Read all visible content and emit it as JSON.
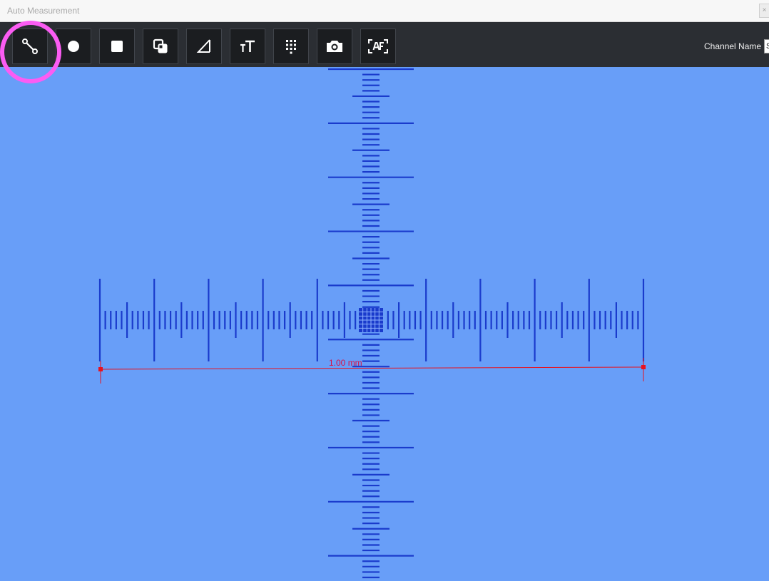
{
  "window": {
    "title": "Auto Measurement",
    "close_glyph": "×"
  },
  "toolbar": {
    "tools": [
      {
        "id": "line",
        "icon": "line-measure-icon"
      },
      {
        "id": "circle",
        "icon": "circle-icon"
      },
      {
        "id": "rectangle",
        "icon": "square-icon"
      },
      {
        "id": "overlap",
        "icon": "overlap-squares-icon"
      },
      {
        "id": "angle",
        "icon": "angle-triangle-icon"
      },
      {
        "id": "text",
        "icon": "text-size-icon"
      },
      {
        "id": "grid",
        "icon": "dot-grid-icon"
      },
      {
        "id": "capture",
        "icon": "camera-icon"
      },
      {
        "id": "autofocus",
        "icon": "autofocus-icon"
      }
    ],
    "channel_label": "Channel Name",
    "channel_value": "S"
  },
  "measurement": {
    "label": "1.00 mm"
  },
  "colors": {
    "viewport_bg": "#689ef8",
    "reticle": "#1a3bcc",
    "measure_line": "#e8121e",
    "highlight": "#fb5cf3",
    "toolbar_bg": "#2b2e33"
  }
}
